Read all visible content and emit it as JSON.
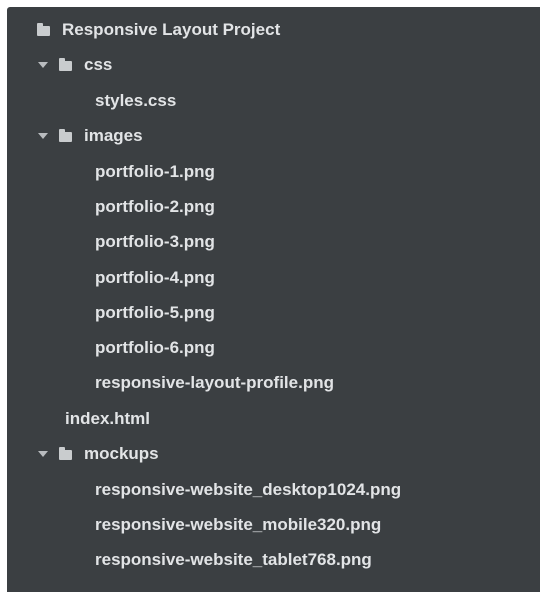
{
  "project": {
    "name": "Responsive Layout Project"
  },
  "tree": {
    "css": {
      "name": "css",
      "files": [
        "styles.css"
      ]
    },
    "images": {
      "name": "images",
      "files": [
        "portfolio-1.png",
        "portfolio-2.png",
        "portfolio-3.png",
        "portfolio-4.png",
        "portfolio-5.png",
        "portfolio-6.png",
        "responsive-layout-profile.png"
      ]
    },
    "index_file": "index.html",
    "mockups": {
      "name": "mockups",
      "files": [
        "responsive-website_desktop1024.png",
        "responsive-website_mobile320.png",
        "responsive-website_tablet768.png"
      ]
    }
  },
  "icons": {
    "folder": "folder-icon",
    "caret": "caret-down-icon"
  },
  "colors": {
    "background": "#3b3f42",
    "text": "#e2e4e6",
    "icon": "#c9ccce"
  }
}
